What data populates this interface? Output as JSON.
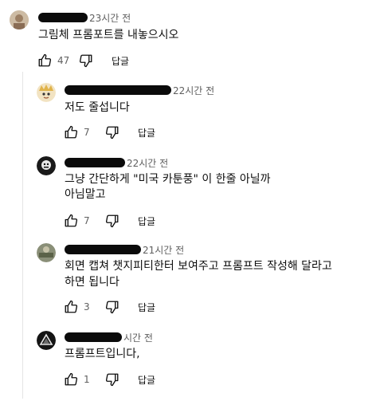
{
  "top_comment": {
    "timestamp": "23시간 전",
    "text": "그림체 프롬포트를 내놓으시오",
    "likes": "47",
    "reply_label": "답글"
  },
  "replies": [
    {
      "timestamp": "22시간 전",
      "lines": [
        "저도 줄섭니다"
      ],
      "likes": "7",
      "reply_label": "답글"
    },
    {
      "timestamp": "22시간 전",
      "lines": [
        "그냥 간단하게 \"미국 카툰풍\" 이 한줄 아닐까",
        "아님말고"
      ],
      "likes": "7",
      "reply_label": "답글"
    },
    {
      "timestamp": "21시간 전",
      "lines": [
        "회면 캡쳐  챗지피티한터 보여주고 프롬프트 작성해 달라고",
        "하면 됩니다"
      ],
      "likes": "3",
      "reply_label": "답글"
    },
    {
      "timestamp": "시간 전",
      "lines": [
        "프롬프트입니다,"
      ],
      "likes": "1",
      "reply_label": "답글"
    }
  ],
  "icons": {
    "like": "thumb-up-icon",
    "dislike": "thumb-down-icon"
  }
}
